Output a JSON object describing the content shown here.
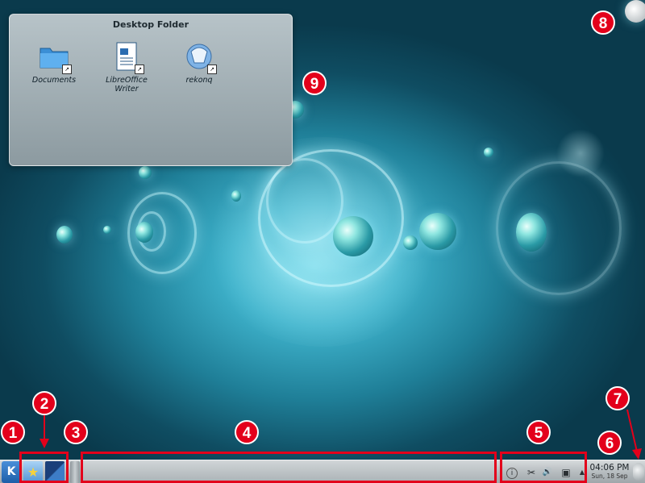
{
  "folder": {
    "title": "Desktop Folder",
    "items": [
      {
        "label": "Documents",
        "icon": "folder-icon"
      },
      {
        "label": "LibreOffice Writer",
        "icon": "writer-icon"
      },
      {
        "label": "rekonq",
        "icon": "rekonq-icon"
      }
    ]
  },
  "annotations": [
    "1",
    "2",
    "3",
    "4",
    "5",
    "6",
    "7",
    "8",
    "9"
  ],
  "clock": {
    "time": "04:06 PM",
    "date": "Sun, 18 Sep"
  },
  "tray": {
    "info": "i",
    "cut": "✂",
    "volume": "🔊",
    "network": "▣",
    "expand": "▲"
  },
  "colors": {
    "annotation": "#e3001b",
    "panel": "#b6bcbf",
    "wallpaper": "#1f7f98"
  }
}
